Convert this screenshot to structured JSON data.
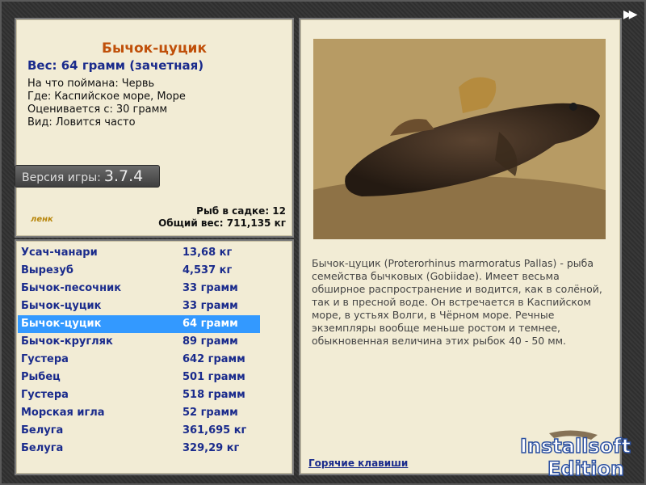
{
  "info": {
    "fish_name": "Бычок-цуцик",
    "weight_line": "Вес: 64 грамм (зачетная)",
    "bait_label": "На что поймана:",
    "bait_value": "Червь",
    "where_label": "Где:",
    "where_value": "Каспийское море, Море",
    "rated_label": "Оценивается с:",
    "rated_value": "30 грамм",
    "kind_label": "Вид:",
    "kind_value": "Ловится часто",
    "version_label": "Версия игры:",
    "version_value": "3.7.4",
    "logo_text": "ленк",
    "fish_in_keepnet": "Рыб в садке: 12",
    "total_weight": "Общий вес: 711,135 кг"
  },
  "catch_list": [
    {
      "name": "Усач-чанари",
      "weight": "13,68 кг"
    },
    {
      "name": "Вырезуб",
      "weight": "4,537 кг"
    },
    {
      "name": "Бычок-песочник",
      "weight": "33 грамм"
    },
    {
      "name": "Бычок-цуцик",
      "weight": "33 грамм"
    },
    {
      "name": "Бычок-цуцик",
      "weight": "64 грамм",
      "selected": true
    },
    {
      "name": "Бычок-кругляк",
      "weight": "89 грамм"
    },
    {
      "name": "Густера",
      "weight": "642 грамм"
    },
    {
      "name": "Рыбец",
      "weight": "501 грамм"
    },
    {
      "name": "Густера",
      "weight": "518 грамм"
    },
    {
      "name": "Морская игла",
      "weight": "52 грамм"
    },
    {
      "name": "Белуга",
      "weight": "361,695 кг"
    },
    {
      "name": "Белуга",
      "weight": "329,29 кг"
    }
  ],
  "detail": {
    "description": "Бычок-цуцик (Proterorhinus marmoratus Pallas) - рыба семейства бычковых (Gobiidae). Имеет весьма обширное распространение и водится, как в солёной, так и в пресной воде. Он встречается в Каспийском море, в устьях Волги, в Чёрном море. Речные экземпляры вообще меньше ростом и темнее, обыкновенная величина этих рыбок 40 - 50 мм.",
    "hotkeys_link": "Горячие клавиши"
  },
  "watermark": {
    "line1": "Installsoft",
    "line2": "Edition"
  },
  "colors": {
    "title": "#c0500a",
    "list_text": "#1a2b8c",
    "selection": "#3399ff",
    "panel_bg": "#f2ecd5"
  }
}
